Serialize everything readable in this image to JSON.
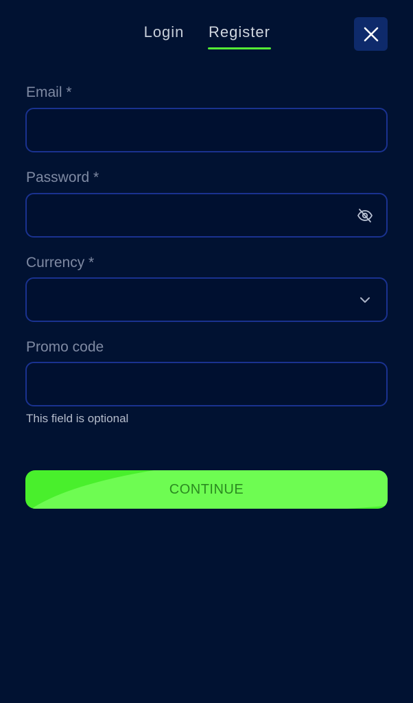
{
  "tabs": [
    {
      "label": "Login",
      "active": false
    },
    {
      "label": "Register",
      "active": true
    }
  ],
  "icons": {
    "close": "close-icon",
    "password_toggle": "eye-slash-icon",
    "currency_dropdown": "chevron-down-icon"
  },
  "form": {
    "email": {
      "label": "Email *",
      "value": "",
      "placeholder": ""
    },
    "password": {
      "label": "Password *",
      "value": "",
      "placeholder": ""
    },
    "currency": {
      "label": "Currency *",
      "value": ""
    },
    "promo": {
      "label": "Promo code",
      "value": "",
      "placeholder": "",
      "hint": "This field is optional"
    }
  },
  "continue_label": "CONTINUE",
  "colors": {
    "background": "#011232",
    "accent": "#54f135",
    "field_border": "#1a3290",
    "close_bg": "#0e2a6b"
  }
}
